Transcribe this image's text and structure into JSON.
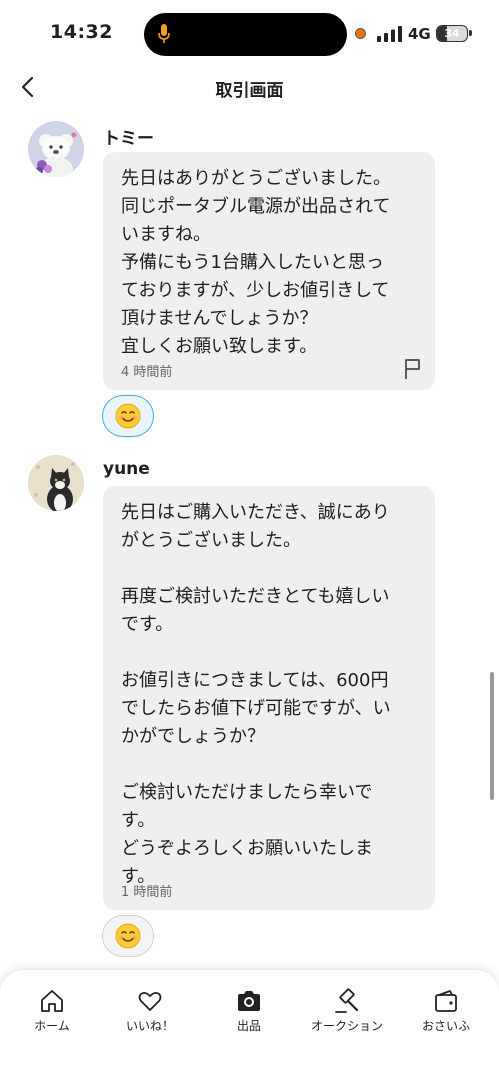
{
  "status_bar": {
    "time": "14:32",
    "network": "4G",
    "battery": "34",
    "battery_level": 0.34
  },
  "header": {
    "title": "取引画面"
  },
  "messages": [
    {
      "name": "トミー",
      "text": "先日はありがとうございました。\n同じポータブル電源が出品されて\nいますね。\n予備にもう1台購入したいと思っ\nておりますが、少しお値引きして\n頂けませんでしょうか？\n宜しくお願い致します。",
      "time": "4 時間前",
      "reaction": "😊"
    },
    {
      "name": "yune",
      "text": "先日はご購入いただき、誠にあり\nがとうございました。\n\n再度ご検討いただきとても嬉しい\nです。\n\nお値引きにつきましては、600円\nでしたらお値下げ可能ですが、い\nかがでしょうか？\n\nご検討いただけましたら幸いで\nす。\nどうぞよろしくお願いいたしま\nす。",
      "time": "1 時間前",
      "reaction": "😊"
    }
  ],
  "bottom_nav": [
    {
      "label": "ホーム",
      "icon": "home-icon"
    },
    {
      "label": "いいね！",
      "icon": "heart-icon"
    },
    {
      "label": "出品",
      "icon": "camera-icon"
    },
    {
      "label": "オークション",
      "icon": "gavel-icon"
    },
    {
      "label": "おさいふ",
      "icon": "wallet-icon"
    }
  ],
  "colors": {
    "accent": "#4aaad9",
    "bubble": "#efefef",
    "recording": "#e8740c",
    "mic": "#f0a020"
  }
}
